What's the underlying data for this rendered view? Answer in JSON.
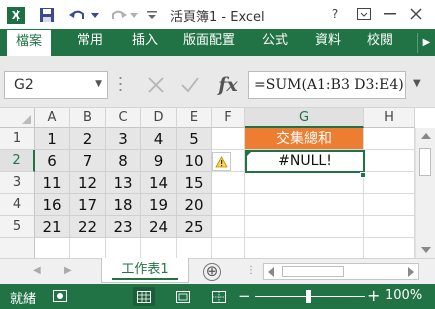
{
  "titlebar": {
    "app_icon": "excel-logo-icon",
    "logo_letter": "X",
    "title": "活頁簿1 - Excel",
    "help_label": "?"
  },
  "ribbon": {
    "tabs": [
      "檔案",
      "常用",
      "插入",
      "版面配置",
      "公式",
      "資料",
      "校閱"
    ]
  },
  "formula_bar": {
    "name_box": "G2",
    "formula": "=SUM(A1:B3 D3:E4)",
    "fx_label": "fx"
  },
  "columns": [
    "A",
    "B",
    "C",
    "D",
    "E",
    "F",
    "G",
    "H"
  ],
  "rows": [
    "1",
    "2",
    "3",
    "4",
    "5"
  ],
  "cells": [
    [
      "1",
      "2",
      "3",
      "4",
      "5"
    ],
    [
      "6",
      "7",
      "8",
      "9",
      "10"
    ],
    [
      "11",
      "12",
      "13",
      "14",
      "15"
    ],
    [
      "16",
      "17",
      "18",
      "19",
      "20"
    ],
    [
      "21",
      "22",
      "23",
      "24",
      "25"
    ]
  ],
  "g_column": {
    "header_cell": "交集總和",
    "result_cell": "#NULL!"
  },
  "selected_cell": "G2",
  "sheet_tabs": {
    "active_sheet": "工作表1",
    "add_label": "⊕",
    "dots": "⋮"
  },
  "status_bar": {
    "status": "就緒",
    "zoom": "100%"
  },
  "colors": {
    "accent": "#217346",
    "header_fill": "#ED7D31",
    "range_fill": "#E6E6E6"
  }
}
